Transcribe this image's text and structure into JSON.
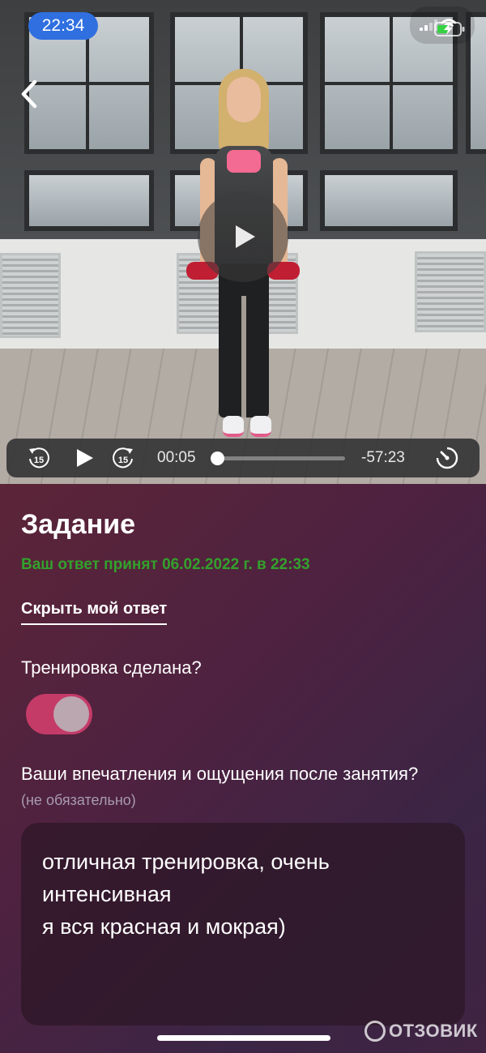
{
  "status_bar": {
    "time": "22:34"
  },
  "player": {
    "current_time": "00:05",
    "remaining_time": "-57:23",
    "skip_seconds": "15",
    "progress": 0.002
  },
  "task": {
    "title": "Задание",
    "accepted_text": "Ваш ответ принят 06.02.2022 г. в 22:33",
    "hide_answer_link": "Скрыть мой ответ",
    "workout_done_question": "Тренировка сделана?",
    "workout_done": true,
    "impressions_question": "Ваши впечатления и ощущения после занятия?",
    "impressions_optional": "(не обязательно)",
    "answer_lines": [
      "отличная тренировка, очень",
      "интенсивная",
      "я вся красная и мокрая)"
    ]
  },
  "colors": {
    "accepted_green": "#33a12c",
    "toggle_on": "#c43b68",
    "status_time_bg": "#2f6fe0"
  },
  "watermark": {
    "text": "ОТЗОВИК"
  }
}
